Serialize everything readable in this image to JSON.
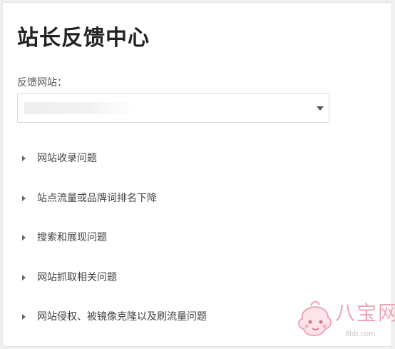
{
  "page": {
    "title": "站长反馈中心"
  },
  "form": {
    "site_label": "反馈网站：",
    "site_value": "example-site"
  },
  "faq": [
    {
      "label": "网站收录问题"
    },
    {
      "label": "站点流量或品牌词排名下降"
    },
    {
      "label": "搜索和展现问题"
    },
    {
      "label": "网站抓取相关问题"
    },
    {
      "label": "网站侵权、被镜像克隆以及刷流量问题"
    }
  ],
  "watermark": {
    "text": "八宝网",
    "url": "8bb.com"
  },
  "colors": {
    "background": "#eef0f2",
    "panel": "#ffffff",
    "title": "#222222",
    "text": "#444444",
    "watermark": "#f1a5b8"
  }
}
